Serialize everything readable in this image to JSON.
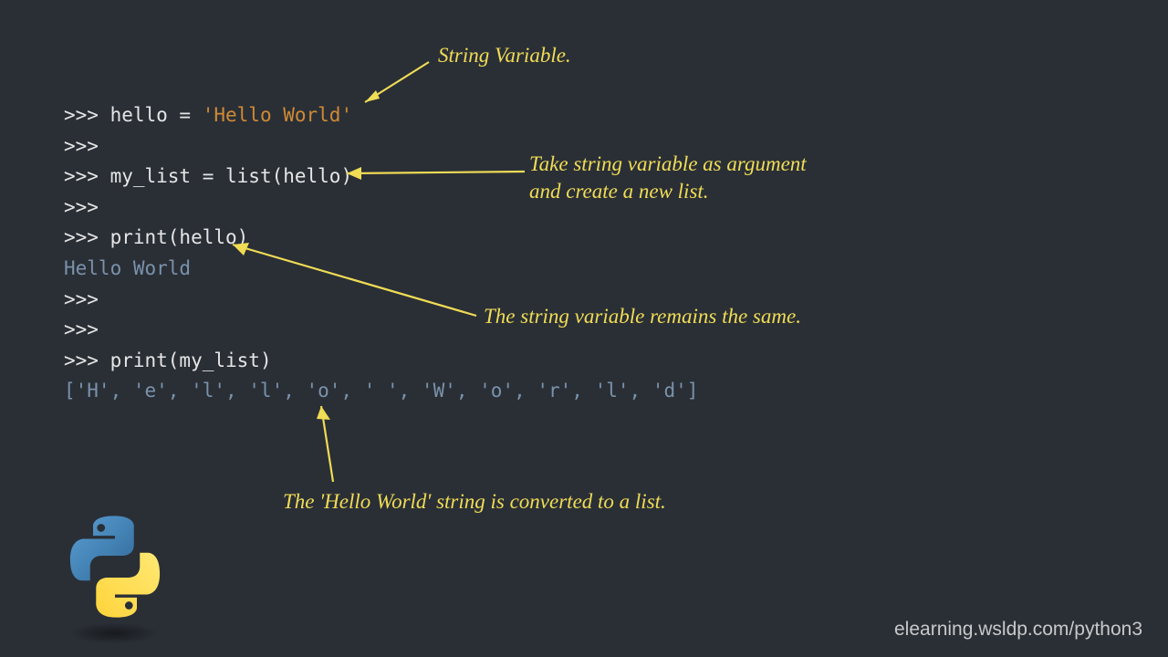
{
  "code": {
    "l1_prompt": ">>> ",
    "l1_var": "hello = ",
    "l1_str": "'Hello World'",
    "l2": ">>>",
    "l3_prompt": ">>> ",
    "l3_code": "my_list = list(hello)",
    "l4": ">>>",
    "l5_prompt": ">>> ",
    "l5_code": "print(hello)",
    "l6_out": "Hello World",
    "l7": ">>>",
    "l8": ">>>",
    "l9_prompt": ">>> ",
    "l9_code": "print(my_list)",
    "l10_out": "['H', 'e', 'l', 'l', 'o', ' ', 'W', 'o', 'r', 'l', 'd']"
  },
  "annotations": {
    "a1": "String Variable.",
    "a2_l1": "Take string variable as argument",
    "a2_l2": "and create a new list.",
    "a3": "The string variable remains the same.",
    "a4": "The 'Hello World' string is converted to a list."
  },
  "watermark": "elearning.wsldp.com/python3"
}
